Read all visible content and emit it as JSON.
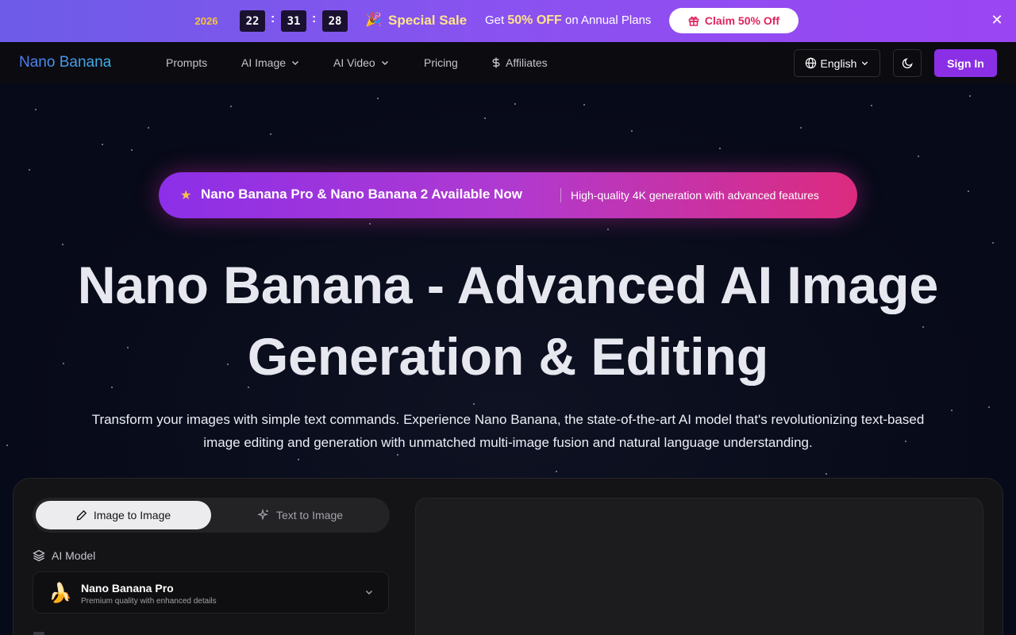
{
  "promo": {
    "year": "2026",
    "countdown": {
      "hours": "22",
      "minutes": "31",
      "seconds": "28",
      "sep": ":"
    },
    "party_icon": "party-popper-icon",
    "sale_label": "Special Sale",
    "get_prefix": "Get",
    "discount": "50% OFF",
    "get_suffix": "on Annual Plans",
    "claim_label": "Claim 50% Off",
    "close_glyph": "✕"
  },
  "nav": {
    "logo": "Nano Banana",
    "links": {
      "prompts": "Prompts",
      "ai_image": "AI Image",
      "ai_video": "AI Video",
      "pricing": "Pricing",
      "affiliates": "Affiliates"
    },
    "language": "English",
    "signin": "Sign In"
  },
  "hero": {
    "announce_title": "Nano Banana Pro & Nano Banana 2 Available Now",
    "announce_sub": "High-quality 4K generation with advanced features",
    "title_line1": "Nano Banana - Advanced AI Image",
    "title_line2": "Generation & Editing",
    "lead_line1": "Transform your images with simple text commands. Experience Nano Banana, the state-of-the-art AI model that's revolutionizing text-based",
    "lead_line2": "image editing and generation with unmatched multi-image fusion and natural language understanding."
  },
  "generator": {
    "tabs": {
      "image_to_image": "Image to Image",
      "text_to_image": "Text to Image"
    },
    "model_label": "AI Model",
    "model": {
      "name": "Nano Banana Pro",
      "desc": "Premium quality with enhanced details",
      "emoji": "🍌"
    }
  },
  "colors": {
    "promo_start": "#6d5ce8",
    "promo_end": "#9b45f2",
    "sale_yellow": "#ffe48a",
    "claim_red": "#e0245e",
    "signin_purple": "#8b2fe6",
    "announce_start": "#8c2fe8",
    "announce_end": "#dc2b7e"
  }
}
